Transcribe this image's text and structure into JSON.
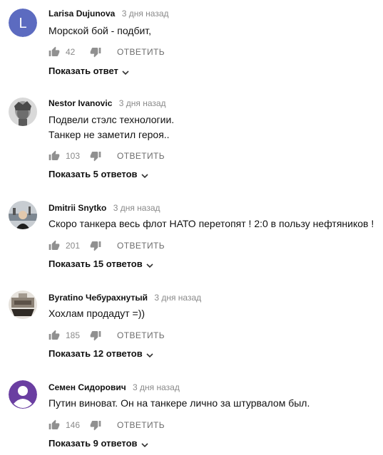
{
  "comments": [
    {
      "author": "Larisa Dujunova",
      "time": "3 дня назад",
      "text": [
        "Морской бой - подбит,"
      ],
      "likes": "42",
      "reply_label": "ОТВЕТИТЬ",
      "replies_label": "Показать ответ",
      "avatar": {
        "type": "letter",
        "letter": "L",
        "color": "#5c6bc0"
      }
    },
    {
      "author": "Nestor Ivanovic",
      "time": "3 дня назад",
      "text": [
        "Подвели стэлс технологии.",
        "Танкер не заметил героя.."
      ],
      "likes": "103",
      "reply_label": "ОТВЕТИТЬ",
      "replies_label": "Показать 5 ответов",
      "avatar": {
        "type": "photo"
      }
    },
    {
      "author": "Dmitrii Snytko",
      "time": "3 дня назад",
      "text": [
        "Скоро танкера весь флот НАТО перетопят ! 2:0 в пользу нефтяников !"
      ],
      "likes": "201",
      "reply_label": "ОТВЕТИТЬ",
      "replies_label": "Показать 15 ответов",
      "avatar": {
        "type": "photo"
      }
    },
    {
      "author": "Byratino Чебурахнутый",
      "time": "3 дня назад",
      "text": [
        "Хохлам продадут =))"
      ],
      "likes": "185",
      "reply_label": "ОТВЕТИТЬ",
      "replies_label": "Показать 12 ответов",
      "avatar": {
        "type": "photo"
      }
    },
    {
      "author": "Семен Сидорович",
      "time": "3 дня назад",
      "text": [
        "Путин виноват. Он на танкере лично за штурвалом был."
      ],
      "likes": "146",
      "reply_label": "ОТВЕТИТЬ",
      "replies_label": "Показать 9 ответов",
      "avatar": {
        "type": "default-user",
        "color": "#6a3ea1"
      }
    }
  ],
  "icons": {
    "like": "thumbs-up-icon",
    "dislike": "thumbs-down-icon",
    "expand": "chevron-down-icon"
  }
}
